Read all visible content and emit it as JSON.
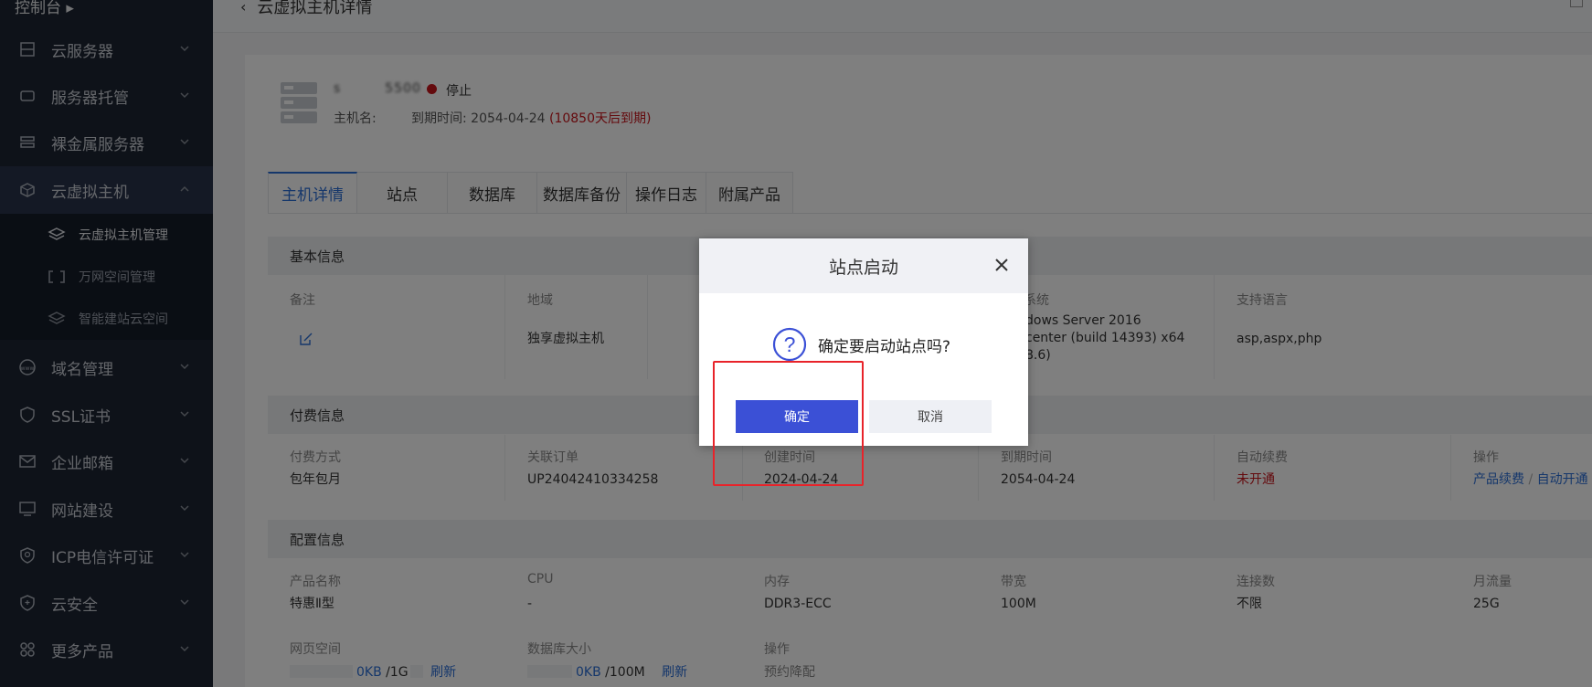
{
  "sidebar": {
    "top_label": "控制台",
    "items": [
      {
        "label": "云服务器"
      },
      {
        "label": "服务器托管"
      },
      {
        "label": "裸金属服务器"
      },
      {
        "label": "云虚拟主机"
      },
      {
        "label": "域名管理"
      },
      {
        "label": "SSL证书"
      },
      {
        "label": "企业邮箱"
      },
      {
        "label": "网站建设"
      },
      {
        "label": "ICP电信许可证"
      },
      {
        "label": "云安全"
      },
      {
        "label": "更多产品"
      }
    ],
    "sub_items": [
      {
        "label": "云虚拟主机管理"
      },
      {
        "label": "万网空间管理"
      },
      {
        "label": "智能建站云空间"
      }
    ]
  },
  "header": {
    "title": "云虚拟主机详情"
  },
  "host": {
    "name": "s      5500",
    "status": "停止",
    "host_label": "主机名:",
    "expire_label": "到期时间: 2054-04-24",
    "expire_left": "(10850天后到期)"
  },
  "tabs": [
    "主机详情",
    "站点",
    "数据库",
    "数据库备份",
    "操作日志",
    "附属产品"
  ],
  "basic": {
    "title": "基本信息",
    "remark_label": "备注",
    "region_label": "地域",
    "region_value": "独享虚拟主机",
    "os_label": "系统",
    "os_value_1": "dows Server 2016",
    "os_value_2": "center (build 14393) x64",
    "os_value_3": "8.6)",
    "lang_label": "支持语言",
    "lang_value": "asp,aspx,php"
  },
  "billing": {
    "title": "付费信息",
    "pay_label": "付费方式",
    "pay_value": "包年包月",
    "order_label": "关联订单",
    "order_value": "UP24042410334258",
    "created_label": "创建时间",
    "created_value": "2024-04-24",
    "expire_label": "到期时间",
    "expire_value": "2054-04-24",
    "renew_label": "自动续费",
    "renew_value": "未开通",
    "ops_label": "操作",
    "ops_renew": "产品续费",
    "ops_sep": "/",
    "ops_auto": "自动开通"
  },
  "config": {
    "title": "配置信息",
    "product_label": "产品名称",
    "product_value": "特惠Ⅱ型",
    "cpu_label": "CPU",
    "cpu_value": "-",
    "mem_label": "内存",
    "mem_value": "DDR3-ECC",
    "bw_label": "带宽",
    "bw_value": "100M",
    "conn_label": "连接数",
    "conn_value": "不限",
    "traffic_label": "月流量",
    "traffic_value": "25G",
    "web_label": "网页空间",
    "web_used": "0KB",
    "web_total": "/1G",
    "web_refresh": "刷新",
    "db_label": "数据库大小",
    "db_used": "0KB",
    "db_total": "/100M",
    "db_refresh": "刷新",
    "ops_label": "操作",
    "ops_value": "预约降配"
  },
  "modal": {
    "title": "站点启动",
    "message": "确定要启动站点吗?",
    "ok": "确定",
    "cancel": "取消"
  },
  "colors": {
    "primary": "#3b50d6",
    "link": "#2b6ed7",
    "danger": "#c8141b",
    "highlight": "#e8232a"
  }
}
